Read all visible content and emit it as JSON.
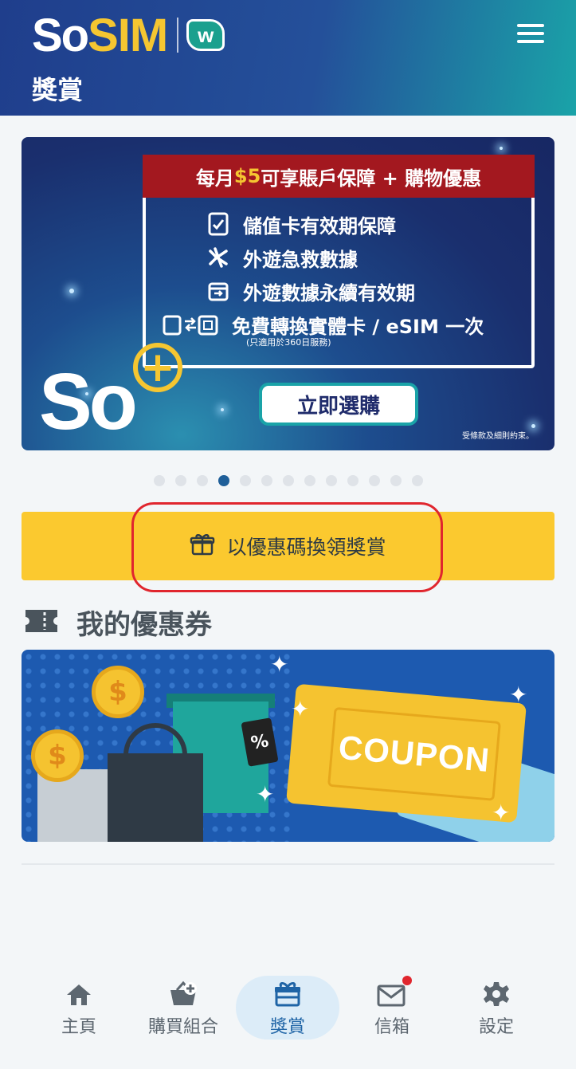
{
  "header": {
    "logo_so": "So",
    "logo_sim": "SIM",
    "logo_partner": "w",
    "title": "獎賞"
  },
  "banner": {
    "headline_prefix": "每月",
    "headline_price": "$5",
    "headline_suffix": "可享賬戶保障 + 購物優惠",
    "items": [
      {
        "icon": "document-check-icon",
        "text": "儲值卡有效期保障"
      },
      {
        "icon": "airplane-icon",
        "text": "外遊急救數據"
      },
      {
        "icon": "calendar-icon",
        "text": "外遊數據永續有效期"
      },
      {
        "icon": "sim-swap-icon",
        "text": "免費轉換實體卡 / eSIM 一次"
      }
    ],
    "note": "(只適用於360日服務)",
    "cta": "立即選購",
    "brand_text": "So",
    "terms": "受條款及細則約束。"
  },
  "carousel": {
    "total": 13,
    "active_index": 3
  },
  "redeem": {
    "label": "以優惠碼換領獎賞"
  },
  "coupons": {
    "title": "我的優惠券",
    "card_text": "COUPON",
    "tag_text": "%"
  },
  "bottom_nav": [
    {
      "label": "主頁",
      "icon": "home-icon"
    },
    {
      "label": "購買組合",
      "icon": "shopping-basket-icon"
    },
    {
      "label": "獎賞",
      "icon": "gift-icon",
      "active": true
    },
    {
      "label": "信箱",
      "icon": "mail-icon",
      "badge": true
    },
    {
      "label": "設定",
      "icon": "gear-icon"
    }
  ],
  "colors": {
    "accent": "#1f64a6",
    "yellow": "#fbc92f",
    "highlight_red": "#e0262e",
    "header_start": "#1f3e8c",
    "header_end": "#1aa3a8"
  }
}
